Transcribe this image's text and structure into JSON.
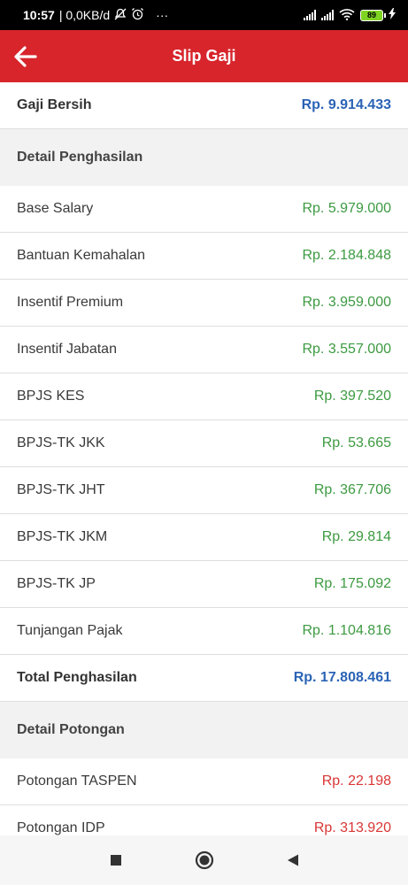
{
  "status": {
    "time": "10:57",
    "network": "| 0,0KB/d",
    "dots": "···",
    "battery": "89"
  },
  "header": {
    "title": "Slip Gaji"
  },
  "net_salary": {
    "label": "Gaji Bersih",
    "value": "Rp. 9.914.433"
  },
  "income": {
    "title": "Detail Penghasilan",
    "items": [
      {
        "label": "Base Salary",
        "value": "Rp. 5.979.000"
      },
      {
        "label": "Bantuan Kemahalan",
        "value": "Rp. 2.184.848"
      },
      {
        "label": "Insentif Premium",
        "value": "Rp. 3.959.000"
      },
      {
        "label": "Insentif Jabatan",
        "value": "Rp. 3.557.000"
      },
      {
        "label": "BPJS KES",
        "value": "Rp. 397.520"
      },
      {
        "label": "BPJS-TK JKK",
        "value": "Rp. 53.665"
      },
      {
        "label": "BPJS-TK JHT",
        "value": "Rp. 367.706"
      },
      {
        "label": "BPJS-TK JKM",
        "value": "Rp. 29.814"
      },
      {
        "label": "BPJS-TK JP",
        "value": "Rp. 175.092"
      },
      {
        "label": "Tunjangan Pajak",
        "value": "Rp. 1.104.816"
      }
    ],
    "total_label": "Total Penghasilan",
    "total_value": "Rp. 17.808.461"
  },
  "deductions": {
    "title": "Detail Potongan",
    "items": [
      {
        "label": "Potongan TASPEN",
        "value": "Rp. 22.198"
      },
      {
        "label": "Potongan IDP",
        "value": "Rp. 313.920"
      }
    ]
  },
  "colors": {
    "header_red": "#d7252b",
    "income_green": "#3c9a41",
    "total_blue": "#2b63b5",
    "deduction_red": "#d93636"
  },
  "icons": {
    "back": "arrow-left-icon",
    "nav_recents": "square-icon",
    "nav_home": "circle-icon",
    "nav_back": "triangle-back-icon"
  }
}
